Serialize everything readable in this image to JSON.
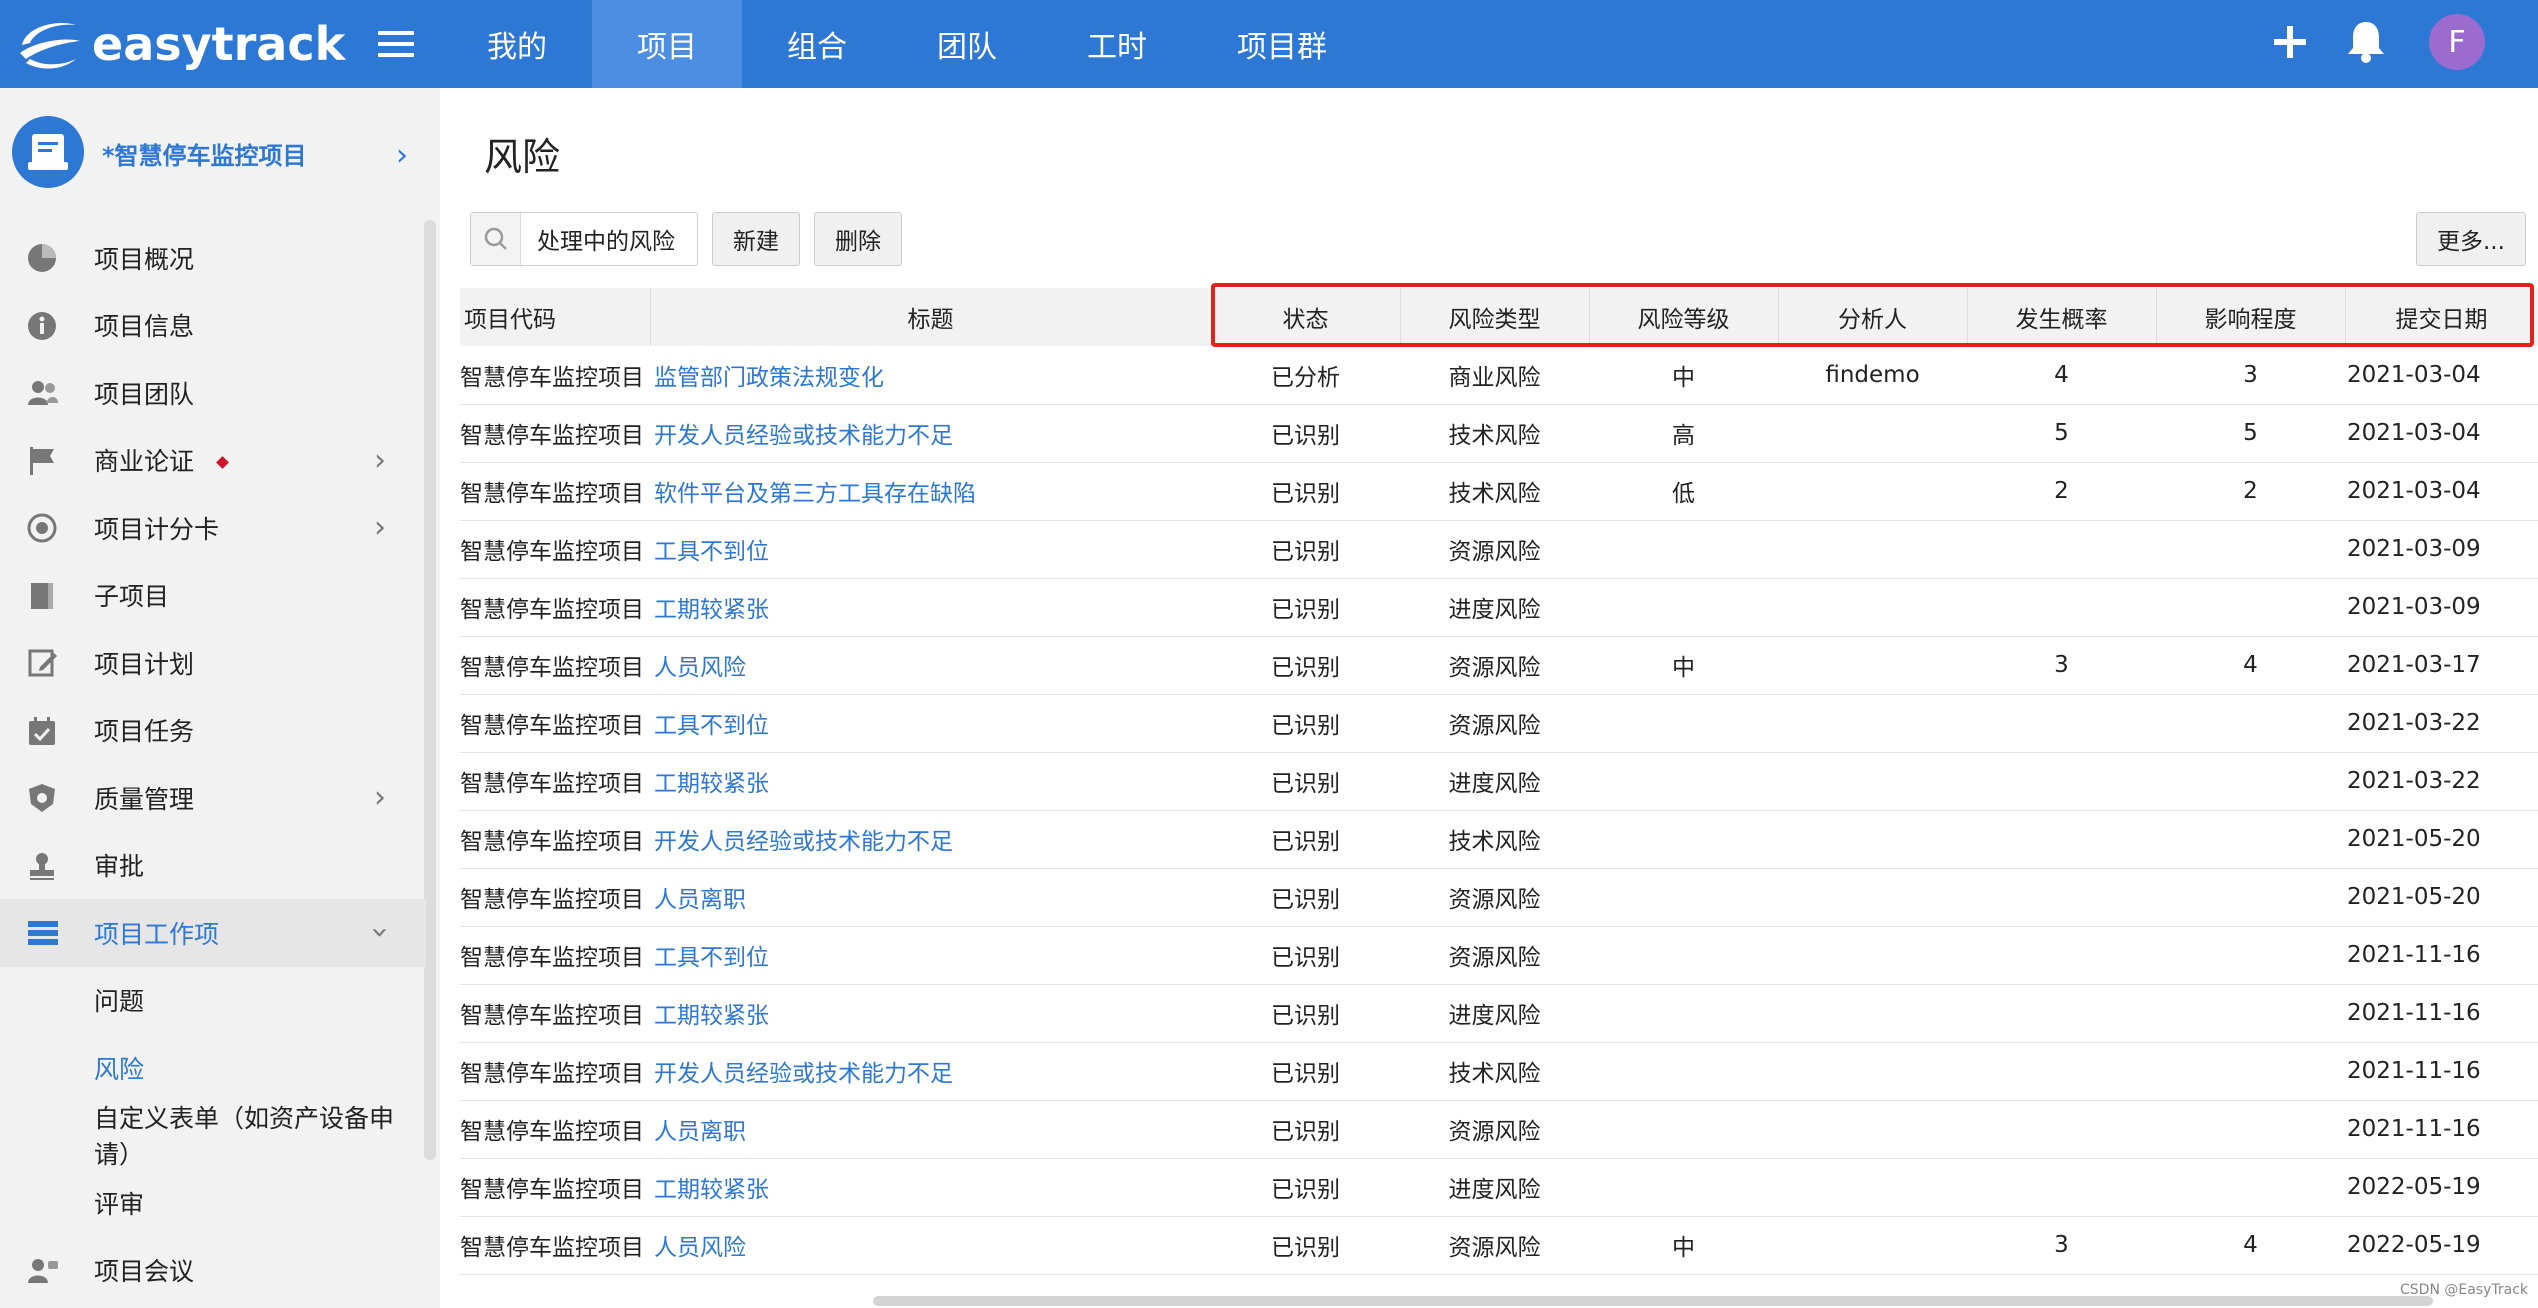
{
  "app": {
    "logo_text": "easytrack",
    "nav": [
      "我的",
      "项目",
      "组合",
      "团队",
      "工时",
      "项目群"
    ],
    "avatar_letter": "F",
    "brand_color": "#2d77d5"
  },
  "sidebar": {
    "project_name": "*智慧停车监控项目",
    "items": [
      {
        "label": "项目概况",
        "icon": "pie-chart-icon"
      },
      {
        "label": "项目信息",
        "icon": "info-icon"
      },
      {
        "label": "项目团队",
        "icon": "team-icon"
      },
      {
        "label": "商业论证",
        "icon": "flag-icon"
      },
      {
        "label": "项目计分卡",
        "icon": "target-icon"
      },
      {
        "label": "子项目",
        "icon": "book-icon"
      },
      {
        "label": "项目计划",
        "icon": "edit-icon"
      },
      {
        "label": "项目任务",
        "icon": "calendar-check-icon"
      },
      {
        "label": "质量管理",
        "icon": "shield-icon"
      },
      {
        "label": "审批",
        "icon": "stamp-icon"
      },
      {
        "label": "项目工作项",
        "icon": "list-icon"
      },
      {
        "label": "问题"
      },
      {
        "label": "风险"
      },
      {
        "label": "自定义表单（如资产设备申请）"
      },
      {
        "label": "评审"
      },
      {
        "label": "项目会议",
        "icon": "meeting-icon"
      }
    ]
  },
  "page": {
    "title": "风险",
    "filter": "处理中的风险",
    "new_label": "新建",
    "delete_label": "删除",
    "more_label": "更多..."
  },
  "table": {
    "headers": [
      "项目代码",
      "标题",
      "状态",
      "风险类型",
      "风险等级",
      "分析人",
      "发生概率",
      "影响程度",
      "提交日期"
    ],
    "rows": [
      [
        "智慧停车监控项目",
        "监管部门政策法规变化",
        "已分析",
        "商业风险",
        "中",
        "findemo",
        "4",
        "3",
        "2021-03-04"
      ],
      [
        "智慧停车监控项目",
        "开发人员经验或技术能力不足",
        "已识别",
        "技术风险",
        "高",
        "",
        "5",
        "5",
        "2021-03-04"
      ],
      [
        "智慧停车监控项目",
        "软件平台及第三方工具存在缺陷",
        "已识别",
        "技术风险",
        "低",
        "",
        "2",
        "2",
        "2021-03-04"
      ],
      [
        "智慧停车监控项目",
        "工具不到位",
        "已识别",
        "资源风险",
        "",
        "",
        "",
        "",
        "2021-03-09"
      ],
      [
        "智慧停车监控项目",
        "工期较紧张",
        "已识别",
        "进度风险",
        "",
        "",
        "",
        "",
        "2021-03-09"
      ],
      [
        "智慧停车监控项目",
        "人员风险",
        "已识别",
        "资源风险",
        "中",
        "",
        "3",
        "4",
        "2021-03-17"
      ],
      [
        "智慧停车监控项目",
        "工具不到位",
        "已识别",
        "资源风险",
        "",
        "",
        "",
        "",
        "2021-03-22"
      ],
      [
        "智慧停车监控项目",
        "工期较紧张",
        "已识别",
        "进度风险",
        "",
        "",
        "",
        "",
        "2021-03-22"
      ],
      [
        "智慧停车监控项目",
        "开发人员经验或技术能力不足",
        "已识别",
        "技术风险",
        "",
        "",
        "",
        "",
        "2021-05-20"
      ],
      [
        "智慧停车监控项目",
        "人员离职",
        "已识别",
        "资源风险",
        "",
        "",
        "",
        "",
        "2021-05-20"
      ],
      [
        "智慧停车监控项目",
        "工具不到位",
        "已识别",
        "资源风险",
        "",
        "",
        "",
        "",
        "2021-11-16"
      ],
      [
        "智慧停车监控项目",
        "工期较紧张",
        "已识别",
        "进度风险",
        "",
        "",
        "",
        "",
        "2021-11-16"
      ],
      [
        "智慧停车监控项目",
        "开发人员经验或技术能力不足",
        "已识别",
        "技术风险",
        "",
        "",
        "",
        "",
        "2021-11-16"
      ],
      [
        "智慧停车监控项目",
        "人员离职",
        "已识别",
        "资源风险",
        "",
        "",
        "",
        "",
        "2021-11-16"
      ],
      [
        "智慧停车监控项目",
        "工期较紧张",
        "已识别",
        "进度风险",
        "",
        "",
        "",
        "",
        "2022-05-19"
      ],
      [
        "智慧停车监控项目",
        "人员风险",
        "已识别",
        "资源风险",
        "中",
        "",
        "3",
        "4",
        "2022-05-19"
      ]
    ]
  },
  "watermark": "CSDN @EasyTrack"
}
